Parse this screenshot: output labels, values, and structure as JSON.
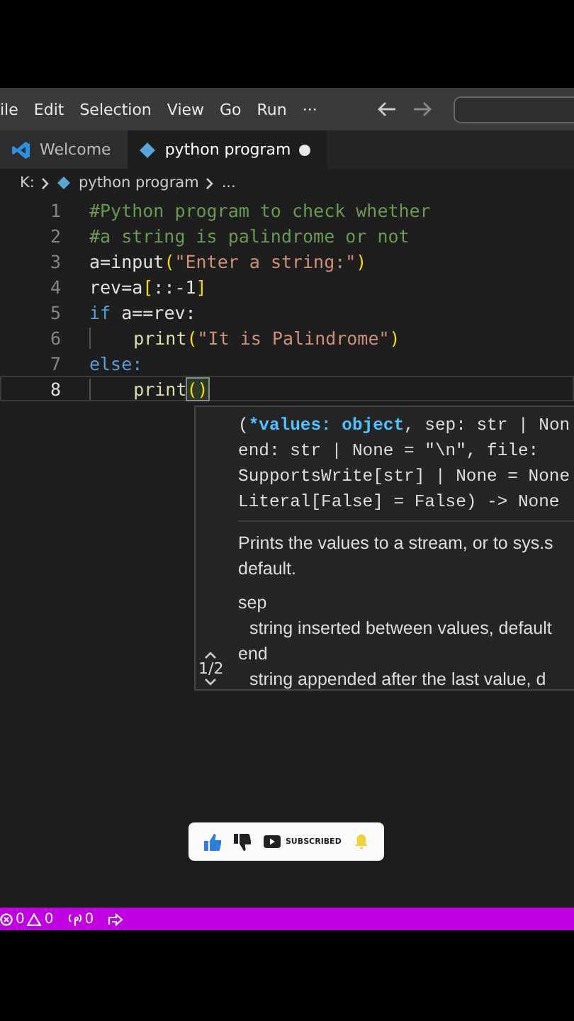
{
  "menu_bar": {
    "items": [
      "ile",
      "Edit",
      "Selection",
      "View",
      "Go",
      "Run",
      "···"
    ]
  },
  "tabs": [
    {
      "label": "Welcome",
      "kind": "welcome",
      "selected": false,
      "modified": false
    },
    {
      "label": "python program",
      "kind": "python",
      "selected": true,
      "modified": true
    }
  ],
  "breadcrumb": [
    "K:",
    "python program",
    "..."
  ],
  "editor": {
    "lines": [
      {
        "number": "1",
        "indent": false,
        "current": false,
        "tokens": [
          {
            "kind": "comment",
            "text": "#Python program to check whether"
          }
        ]
      },
      {
        "number": "2",
        "indent": false,
        "current": false,
        "tokens": [
          {
            "kind": "comment",
            "text": "#a string is palindrome or not"
          }
        ]
      },
      {
        "number": "3",
        "indent": false,
        "current": false,
        "tokens": [
          {
            "kind": "plain",
            "text": "a=input"
          },
          {
            "kind": "bracket",
            "text": "("
          },
          {
            "kind": "string",
            "text": "\"Enter a string:\""
          },
          {
            "kind": "bracket",
            "text": ")"
          }
        ]
      },
      {
        "number": "4",
        "indent": false,
        "current": false,
        "tokens": [
          {
            "kind": "plain",
            "text": "rev=a"
          },
          {
            "kind": "bracket",
            "text": "["
          },
          {
            "kind": "plain",
            "text": "::-1"
          },
          {
            "kind": "bracket",
            "text": "]"
          }
        ]
      },
      {
        "number": "5",
        "indent": false,
        "current": false,
        "tokens": [
          {
            "kind": "keyword",
            "text": "if"
          },
          {
            "kind": "plain",
            "text": " a==rev:"
          }
        ]
      },
      {
        "number": "6",
        "indent": true,
        "current": false,
        "tokens": [
          {
            "kind": "func",
            "text": "print"
          },
          {
            "kind": "bracket",
            "text": "("
          },
          {
            "kind": "string",
            "text": "\"It is Palindrome\""
          },
          {
            "kind": "bracket",
            "text": ")"
          }
        ]
      },
      {
        "number": "7",
        "indent": false,
        "current": false,
        "tokens": [
          {
            "kind": "keyword",
            "text": "else:"
          }
        ]
      },
      {
        "number": "8",
        "indent": true,
        "current": true,
        "tokens": [
          {
            "kind": "func",
            "text": "print"
          },
          {
            "kind": "matched",
            "text": "()"
          }
        ]
      }
    ]
  },
  "hover": {
    "signature": [
      [
        {
          "kind": "plain",
          "text": "("
        },
        {
          "kind": "param",
          "text": "*values: object"
        },
        {
          "kind": "plain",
          "text": ", sep: str | Non"
        }
      ],
      [
        {
          "kind": "plain",
          "text": "end: str | None = \"\\n\", file:"
        }
      ],
      [
        {
          "kind": "plain",
          "text": "SupportsWrite[str] | None = None"
        }
      ],
      [
        {
          "kind": "plain",
          "text": "Literal[False] = False) -> None"
        }
      ]
    ],
    "description": "Prints the values to a stream, or to sys.s default.",
    "params": [
      {
        "name": "sep",
        "text": "string inserted between values, default"
      },
      {
        "name": "end",
        "text": "string appended after the last value, d"
      }
    ],
    "pager": "1/2"
  },
  "overlay": {
    "label": "SUBSCRIBED"
  },
  "status_bar": {
    "errors": "0",
    "warnings": "0",
    "ports": "0"
  }
}
